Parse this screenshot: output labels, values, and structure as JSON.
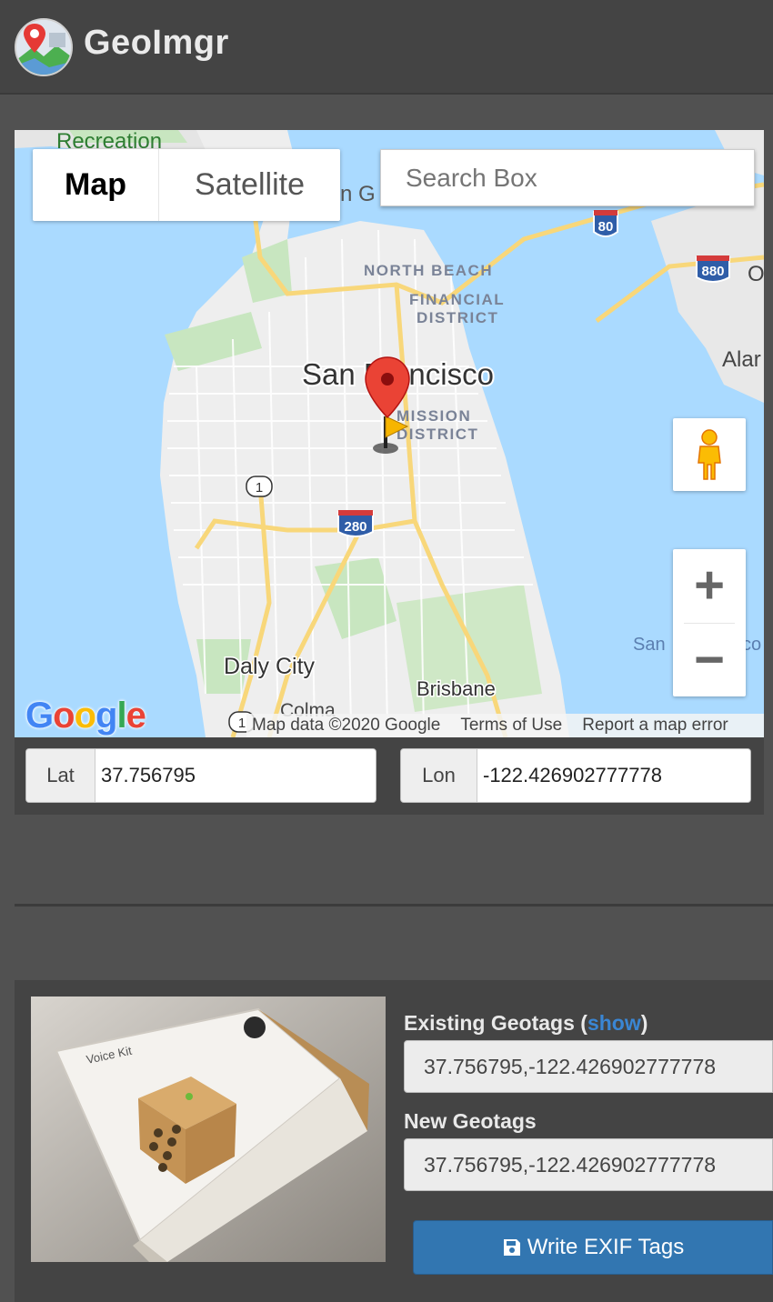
{
  "app": {
    "title": "GeoImgr"
  },
  "map": {
    "type_buttons": {
      "map": "Map",
      "satellite": "Satellite"
    },
    "search_placeholder": "Search Box",
    "labels": {
      "recreation": "Recreation",
      "golden_gate_partial": "n G",
      "north_beach": "NORTH BEACH",
      "financial_1": "FINANCIAL",
      "financial_2": "DISTRICT",
      "san_francisco": "San Francisco",
      "mission_1": "MISSION",
      "mission_2": "DISTRICT",
      "alameda_partial": "Alar",
      "oakland_partial": "O",
      "daly_city": "Daly City",
      "brisbane": "Brisbane",
      "colma": "Colma",
      "san_partial": "San",
      "co_partial": "co",
      "hwy_80": "80",
      "hwy_880": "880",
      "hwy_280": "280",
      "hwy_1": "1",
      "hwy_1b": "1"
    },
    "zoom_in": "+",
    "zoom_out": "−",
    "google": [
      "G",
      "o",
      "o",
      "g",
      "l",
      "e"
    ],
    "google_colors": [
      "#4285F4",
      "#EA4335",
      "#FBBC05",
      "#4285F4",
      "#34A853",
      "#EA4335"
    ],
    "attribution": {
      "data": "Map data ©2020 Google",
      "terms": "Terms of Use",
      "report": "Report a map error"
    }
  },
  "coords": {
    "lat_label": "Lat",
    "lat_value": "37.756795",
    "lon_label": "Lon",
    "lon_value": "-122.426902777778"
  },
  "photo": {
    "existing_label": "Existing Geotags (",
    "show_link": "show",
    "existing_close": ")",
    "existing_value": "37.756795,-122.426902777778",
    "new_label": "New Geotags",
    "new_value": "37.756795,-122.426902777778",
    "write_button": "Write EXIF Tags",
    "box_text": "Voice Kit"
  },
  "colors": {
    "accent": "#3276b1",
    "link": "#3a86d4",
    "water": "#aadaff",
    "marker": "#ea4335"
  }
}
